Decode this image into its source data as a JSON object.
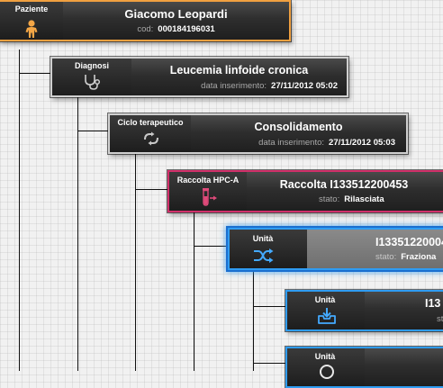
{
  "patient": {
    "type_label": "Paziente",
    "name": "Giacomo Leopardi",
    "sub_key": "cod:",
    "sub_value": "000184196031",
    "icon": "person-icon",
    "accent": "#f0a040"
  },
  "diagnosis": {
    "type_label": "Diagnosi",
    "title": "Leucemia linfoide cronica",
    "sub_key": "data inserimento:",
    "sub_value": "27/11/2012 05:02",
    "icon": "stethoscope-icon"
  },
  "therapy_cycle": {
    "type_label": "Ciclo terapeutico",
    "title": "Consolidamento",
    "sub_key": "data inserimento:",
    "sub_value": "27/11/2012 05:03",
    "icon": "cycle-icon"
  },
  "collection": {
    "type_label": "Raccolta HPC-A",
    "title": "Raccolta I133512200453",
    "sub_key": "stato:",
    "sub_value": "Rilasciata",
    "icon": "blood-tube-icon",
    "accent": "#d2306a"
  },
  "unit_selected": {
    "type_label": "Unità",
    "title": "I13351220004",
    "sub_key": "stato:",
    "sub_value": "Fraziona",
    "icon": "shuffle-icon",
    "accent": "#2f9cf2"
  },
  "unit_2": {
    "type_label": "Unità",
    "title": "I13",
    "sub_key": "st",
    "icon": "inbox-download-icon"
  },
  "unit_3": {
    "type_label": "Unità",
    "icon": "circle-icon"
  }
}
